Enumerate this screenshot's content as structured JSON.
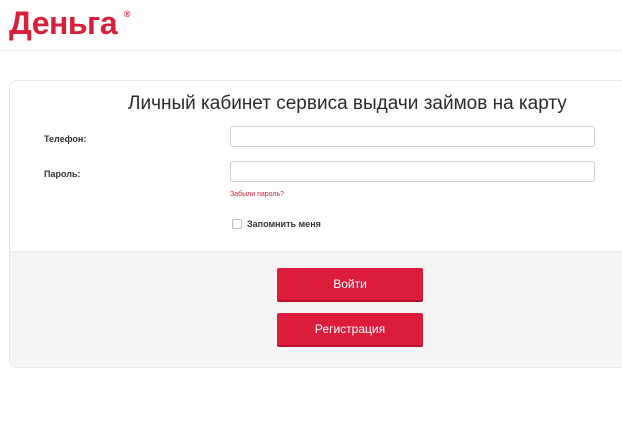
{
  "header": {
    "logo_text": "Деньга",
    "logo_mark": "®"
  },
  "login": {
    "title": "Личный кабинет сервиса выдачи займов на карту",
    "phone_label": "Телефон:",
    "phone_value": "",
    "password_label": "Пароль:",
    "password_value": "",
    "forgot_link": "Забыли пароль?",
    "remember_label": "Запомнить меня",
    "remember_checked": false,
    "login_button": "Войти",
    "register_button": "Регистрация"
  },
  "colors": {
    "brand": "#d81e3a",
    "button": "#dc1c3c"
  }
}
